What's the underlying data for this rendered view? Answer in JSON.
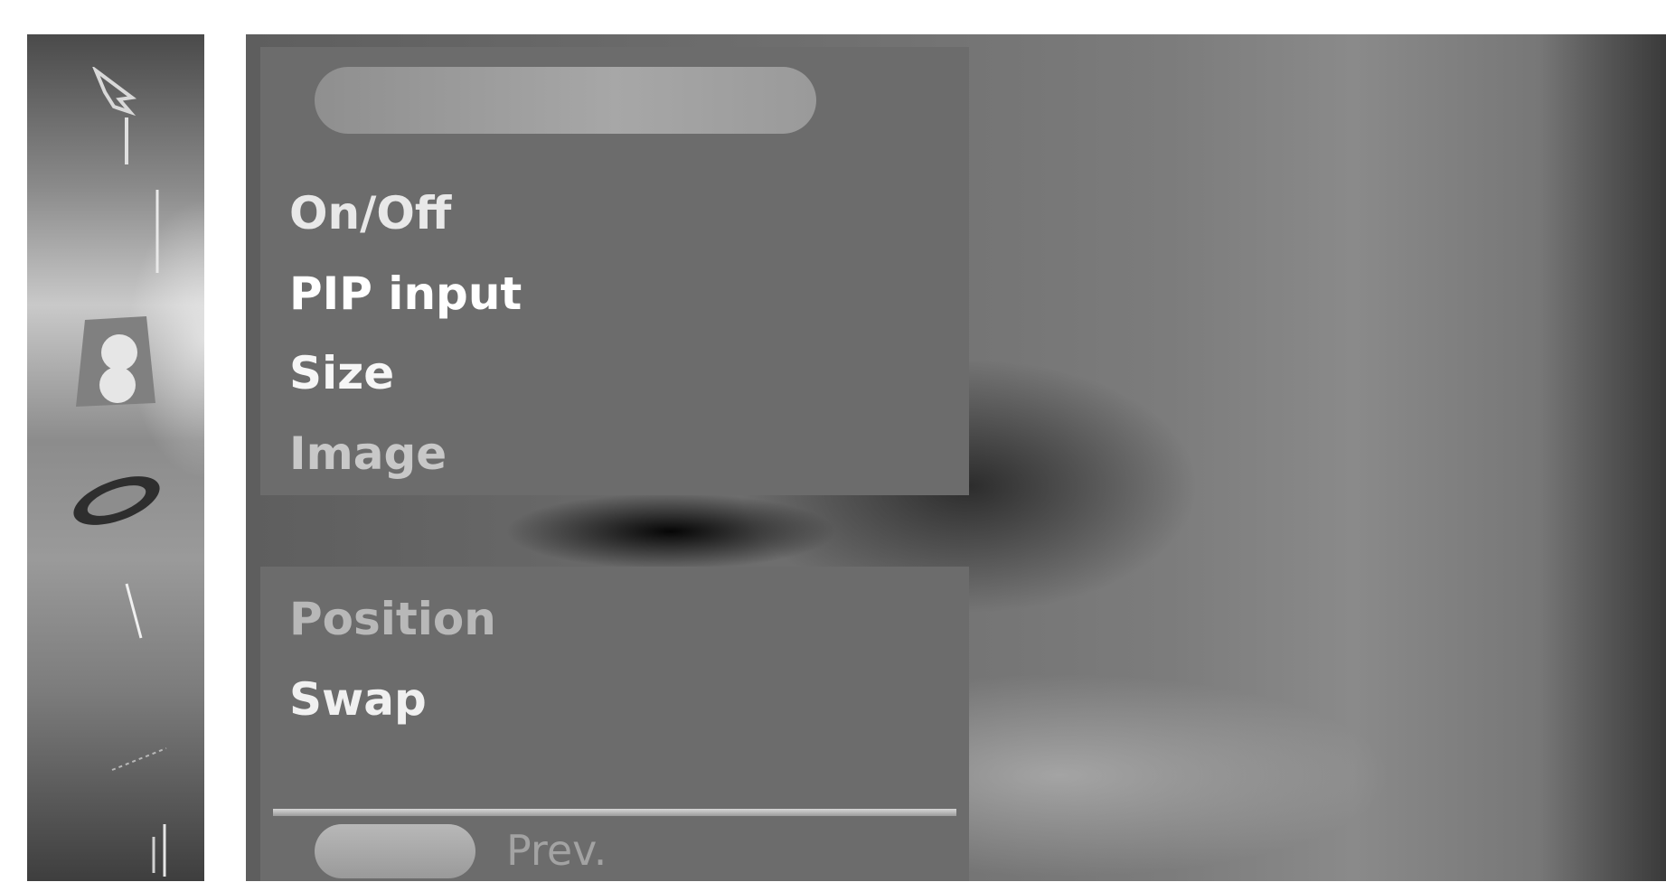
{
  "rail": {
    "icons": [
      "picture-icon",
      "audio-icon",
      "pip-icon",
      "disc-icon",
      "setup-icon",
      "input-icon",
      "lock-icon"
    ]
  },
  "menu": {
    "top_items": [
      "On/Off",
      "PIP input",
      "Size",
      "Image"
    ],
    "bottom_items": [
      "Position",
      "Swap"
    ]
  },
  "footer": {
    "prev_label": "Prev."
  }
}
